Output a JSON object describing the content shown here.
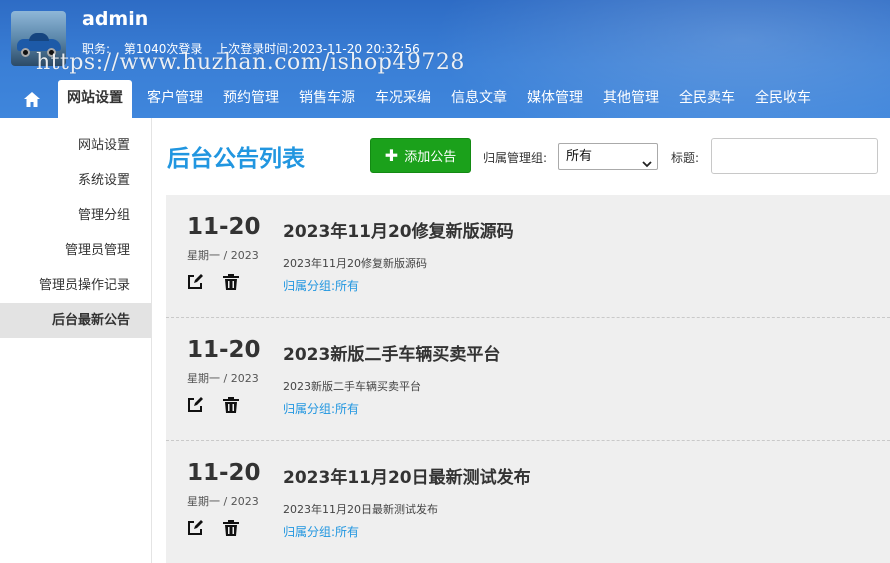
{
  "header": {
    "username": "admin",
    "role_label": "职务:",
    "login_count": "第1040次登录",
    "last_login": "上次登录时间:2023-11-20 20:32:56",
    "watermark": "https://www.huzhan.com/ishop49728"
  },
  "nav": {
    "home_icon": "home-icon",
    "items": [
      {
        "label": "网站设置",
        "active": true
      },
      {
        "label": "客户管理"
      },
      {
        "label": "预约管理"
      },
      {
        "label": "销售车源"
      },
      {
        "label": "车况采编"
      },
      {
        "label": "信息文章"
      },
      {
        "label": "媒体管理"
      },
      {
        "label": "其他管理"
      },
      {
        "label": "全民卖车"
      },
      {
        "label": "全民收车"
      }
    ]
  },
  "sidebar": {
    "items": [
      {
        "label": "网站设置"
      },
      {
        "label": "系统设置"
      },
      {
        "label": "管理分组"
      },
      {
        "label": "管理员管理"
      },
      {
        "label": "管理员操作记录"
      },
      {
        "label": "后台最新公告",
        "active": true
      }
    ]
  },
  "main": {
    "title": "后台公告列表",
    "add_button": "添加公告",
    "filter_label": "归属管理组:",
    "filter_value": "所有",
    "title_label": "标题:",
    "title_input_value": ""
  },
  "announcements": [
    {
      "day": "11-20",
      "weekday": "星期一 / 2023",
      "title": "2023年11月20修复新版源码",
      "desc": "2023年11月20修复新版源码",
      "group": "归属分组:所有"
    },
    {
      "day": "11-20",
      "weekday": "星期一 / 2023",
      "title": "2023新版二手车辆买卖平台",
      "desc": "2023新版二手车辆买卖平台",
      "group": "归属分组:所有"
    },
    {
      "day": "11-20",
      "weekday": "星期一 / 2023",
      "title": "2023年11月20日最新测试发布",
      "desc": "2023年11月20日最新测试发布",
      "group": "归属分组:所有"
    }
  ],
  "colors": {
    "header": "#3a7fd6",
    "accent": "#2196e0",
    "add_button": "#1ba11b"
  }
}
